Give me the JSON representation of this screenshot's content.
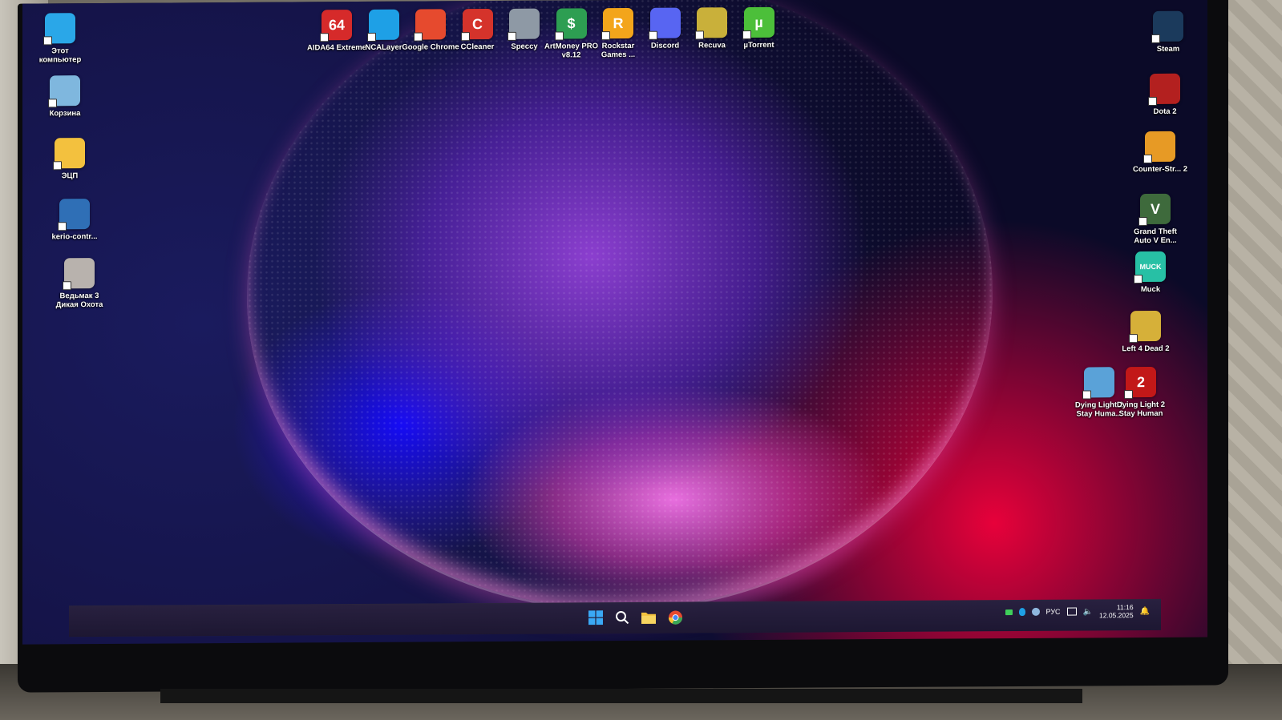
{
  "desktop": {
    "left_icons": [
      {
        "label": "Этот компьютер",
        "icon": "monitor-icon",
        "color": "#2aa7e8"
      },
      {
        "label": "Корзина",
        "icon": "recycle-bin-icon",
        "color": "#7fb7de"
      },
      {
        "label": "ЭЦП",
        "icon": "folder-icon",
        "color": "#f3c13e"
      },
      {
        "label": "kerio-contr...",
        "icon": "kerio-icon",
        "color": "#2f6fb6"
      },
      {
        "label": "Ведьмак 3 Дикая Охота",
        "icon": "witcher-icon",
        "color": "#b8b2ad"
      }
    ],
    "top_icons": [
      {
        "label": "AIDA64 Extreme",
        "icon": "aida64-icon",
        "glyph": "64",
        "color": "#d62a2a"
      },
      {
        "label": "NCALayer",
        "icon": "ncalayer-icon",
        "glyph": "",
        "color": "#1ea0e6"
      },
      {
        "label": "Google Chrome",
        "icon": "chrome-icon",
        "glyph": "",
        "color": "#e64a2e"
      },
      {
        "label": "CCleaner",
        "icon": "ccleaner-icon",
        "glyph": "C",
        "color": "#d5332b"
      },
      {
        "label": "Speccy",
        "icon": "speccy-icon",
        "glyph": "",
        "color": "#8e99a5"
      },
      {
        "label": "ArtMoney PRO v8.12",
        "icon": "artmoney-icon",
        "glyph": "$",
        "color": "#2d9e52"
      },
      {
        "label": "Rockstar Games ...",
        "icon": "rockstar-icon",
        "glyph": "R",
        "color": "#f3a51b"
      },
      {
        "label": "Discord",
        "icon": "discord-icon",
        "glyph": "",
        "color": "#5865f2"
      },
      {
        "label": "Recuva",
        "icon": "recuva-icon",
        "glyph": "",
        "color": "#c9b03a"
      },
      {
        "label": "µTorrent",
        "icon": "utorrent-icon",
        "glyph": "µ",
        "color": "#4cbf3a"
      }
    ],
    "right_icons": [
      {
        "label": "Steam",
        "icon": "steam-icon",
        "glyph": "",
        "color": "#1b3a5c"
      },
      {
        "label": "Dota 2",
        "icon": "dota2-icon",
        "glyph": "",
        "color": "#b3201f"
      },
      {
        "label": "Counter-Str... 2",
        "icon": "counter-strike-icon",
        "glyph": "",
        "color": "#e79a25"
      },
      {
        "label": "Grand Theft Auto V En...",
        "icon": "gta5-icon",
        "glyph": "V",
        "color": "#3e6a3c"
      },
      {
        "label": "Muck",
        "icon": "muck-icon",
        "glyph": "MUCK",
        "color": "#27c0a5"
      },
      {
        "label": "Left 4 Dead 2",
        "icon": "left4dead2-icon",
        "glyph": "",
        "color": "#d6b039"
      },
      {
        "label": "Dying Light 2 Stay Huma...",
        "icon": "dying-light-2-icon",
        "glyph": "",
        "color": "#5aa2d8"
      },
      {
        "label": "Dying Light 2 Stay Human",
        "icon": "dying-light-2-alt-icon",
        "glyph": "2",
        "color": "#c21818"
      }
    ]
  },
  "taskbar": {
    "pinned": [
      {
        "name": "start-button",
        "icon": "windows-icon"
      },
      {
        "name": "search-button",
        "icon": "search-icon"
      },
      {
        "name": "file-explorer-button",
        "icon": "folder-icon"
      },
      {
        "name": "chrome-taskbar-button",
        "icon": "chrome-icon"
      }
    ],
    "tray": {
      "language": "РУС",
      "time": "11:16",
      "date": "12.05.2025"
    }
  }
}
